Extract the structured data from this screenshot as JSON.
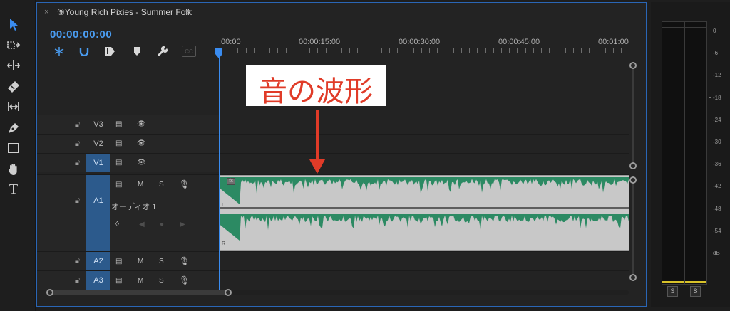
{
  "tools": [
    {
      "name": "selection-tool",
      "icon": "arrow-select-icon"
    },
    {
      "name": "track-select-tool",
      "icon": "track-select-icon"
    },
    {
      "name": "ripple-edit-tool",
      "icon": "ripple-edit-icon"
    },
    {
      "name": "razor-tool",
      "icon": "razor-icon"
    },
    {
      "name": "slip-tool",
      "icon": "slip-icon"
    },
    {
      "name": "pen-tool",
      "icon": "pen-icon"
    },
    {
      "name": "rectangle-tool",
      "icon": "rectangle-icon"
    },
    {
      "name": "hand-tool",
      "icon": "hand-icon"
    },
    {
      "name": "type-tool",
      "icon": "type-icon",
      "label": "T"
    }
  ],
  "tab": {
    "close": "×",
    "title": "⑨Young Rich Pixies - Summer Folk",
    "menu": "≡"
  },
  "timecode": "00:00:00:00",
  "header_icons": [
    "snap-icon",
    "magnet-icon",
    "linked-selection-icon",
    "marker-icon",
    "wrench-icon",
    "captions-icon"
  ],
  "captions_label": "CC",
  "ruler": {
    "labels": [
      ":00:00",
      "00:00:15:00",
      "00:00:30:00",
      "00:00:45:00",
      "00:01:00"
    ]
  },
  "tracks": {
    "video": [
      {
        "name": "V3",
        "selected": false
      },
      {
        "name": "V2",
        "selected": false
      },
      {
        "name": "V1",
        "selected": true
      }
    ],
    "audio": [
      {
        "name": "A1",
        "selected": true,
        "label": "オーディオ 1",
        "m": "M",
        "s": "S"
      },
      {
        "name": "A2",
        "selected": true,
        "m": "M",
        "s": "S"
      },
      {
        "name": "A3",
        "selected": true,
        "m": "M",
        "s": "S"
      }
    ]
  },
  "clip": {
    "fx_label": "fx",
    "channel_left": "L",
    "channel_right": "R",
    "waveform_color": "#2c8a63"
  },
  "annotation": {
    "text": "音の波形",
    "color": "#e03b28"
  },
  "meters": {
    "scale": [
      "0",
      "-6",
      "-12",
      "-18",
      "-24",
      "-30",
      "-36",
      "-42",
      "-48",
      "-54",
      "dB"
    ],
    "solo_buttons": [
      "S",
      "S"
    ]
  },
  "accent_color": "#3a8cf0"
}
